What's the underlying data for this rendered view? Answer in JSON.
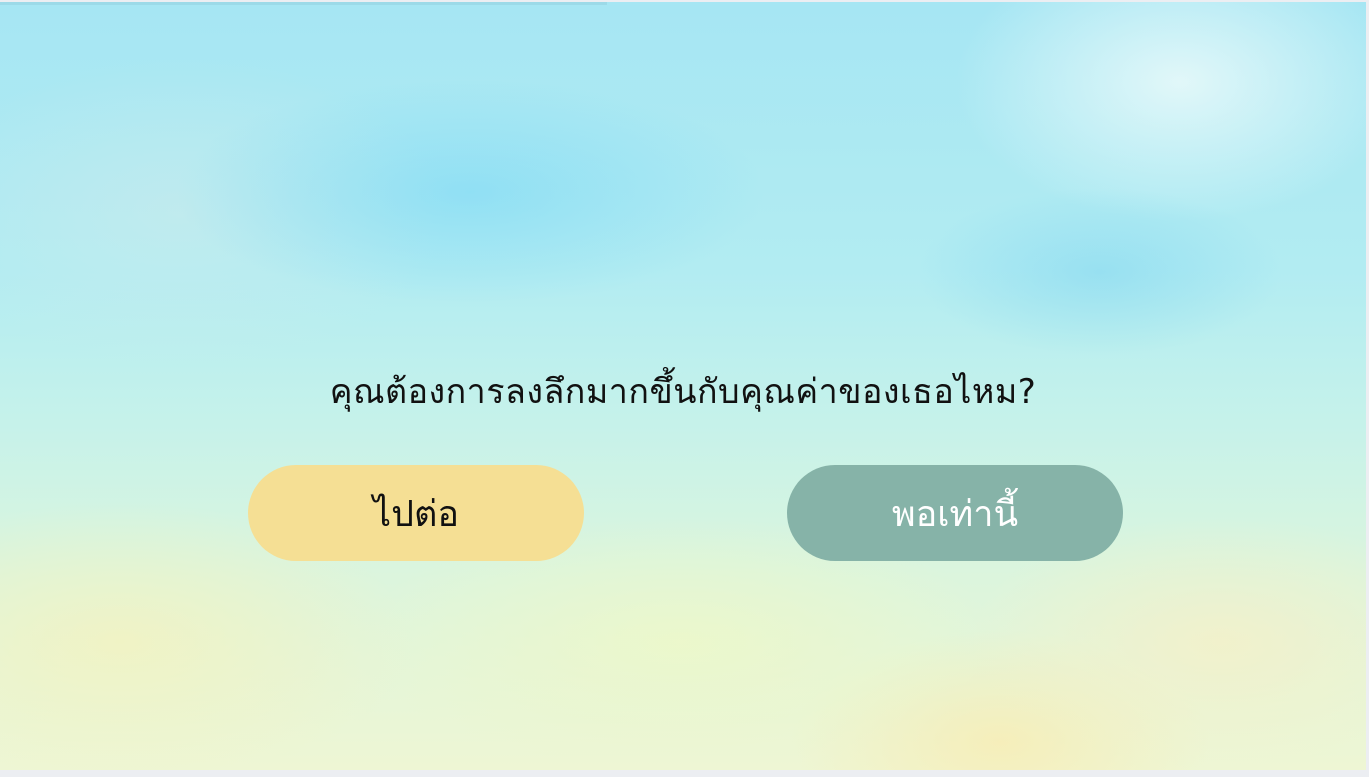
{
  "question": "คุณต้องการลงลึกมากขึ้นกับคุณค่าของเธอไหม?",
  "buttons": {
    "continue_label": "ไปต่อ",
    "stop_label": "พอเท่านี้"
  },
  "colors": {
    "continue_button": "#f5df94",
    "stop_button": "#86b3a8",
    "question_text": "#111111"
  }
}
